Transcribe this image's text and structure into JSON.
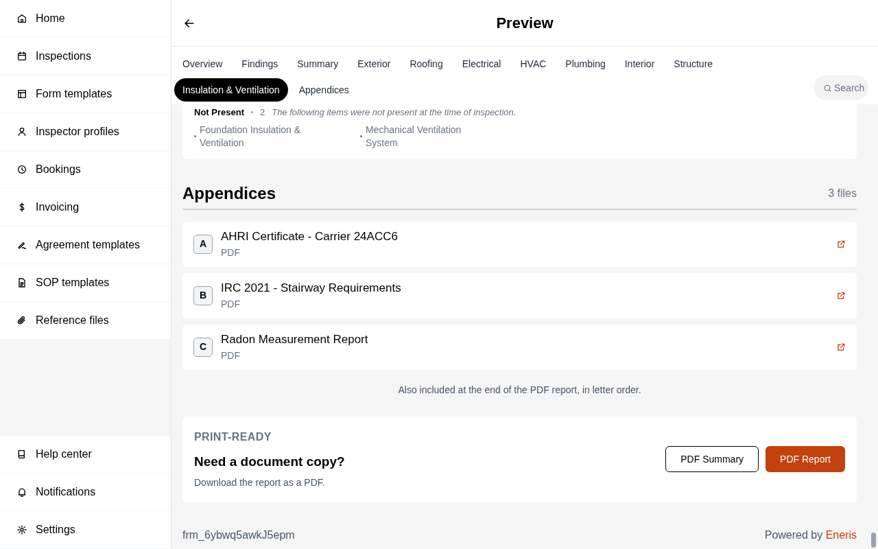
{
  "sidebar": {
    "items": [
      {
        "label": "Home"
      },
      {
        "label": "Inspections"
      },
      {
        "label": "Form templates"
      },
      {
        "label": "Inspector profiles"
      },
      {
        "label": "Bookings"
      },
      {
        "label": "Invoicing"
      },
      {
        "label": "Agreement templates"
      },
      {
        "label": "SOP templates"
      },
      {
        "label": "Reference files"
      }
    ],
    "bottom_items": [
      {
        "label": "Help center"
      },
      {
        "label": "Notifications"
      },
      {
        "label": "Settings"
      }
    ]
  },
  "header": {
    "title": "Preview"
  },
  "tabs": [
    {
      "label": "Overview",
      "selected": false
    },
    {
      "label": "Findings",
      "selected": false
    },
    {
      "label": "Summary",
      "selected": false
    },
    {
      "label": "Exterior",
      "selected": false
    },
    {
      "label": "Roofing",
      "selected": false
    },
    {
      "label": "Electrical",
      "selected": false
    },
    {
      "label": "HVAC",
      "selected": false
    },
    {
      "label": "Plumbing",
      "selected": false
    },
    {
      "label": "Interior",
      "selected": false
    },
    {
      "label": "Structure",
      "selected": false
    },
    {
      "label": "Insulation & Ventilation",
      "selected": true
    },
    {
      "label": "Appendices",
      "selected": false
    }
  ],
  "search": {
    "placeholder": "Search"
  },
  "not_present": {
    "label": "Not Present",
    "count": "2",
    "note": "The following items were not present at the time of inspection.",
    "items": [
      "Foundation Insulation & Ventilation",
      "Mechanical Ventilation System"
    ]
  },
  "appendices": {
    "title": "Appendices",
    "count": "3 files",
    "files": [
      {
        "letter": "A",
        "name": "AHRI Certificate - Carrier 24ACC6",
        "type": "PDF"
      },
      {
        "letter": "B",
        "name": "IRC 2021 - Stairway Requirements",
        "type": "PDF"
      },
      {
        "letter": "C",
        "name": "Radon Measurement Report",
        "type": "PDF"
      }
    ],
    "note": "Also included at the end of the PDF report, in letter order."
  },
  "print": {
    "eyebrow": "PRINT-READY",
    "title": "Need a document copy?",
    "text": "Download the report as a PDF.",
    "buttons": [
      {
        "label": "PDF Summary",
        "kind": "outline"
      },
      {
        "label": "PDF Report",
        "kind": "primary"
      }
    ]
  },
  "footer": {
    "id": "frm_6ybwq5awkJ5epm",
    "powered": "Powered by",
    "brand": "Eneris"
  }
}
